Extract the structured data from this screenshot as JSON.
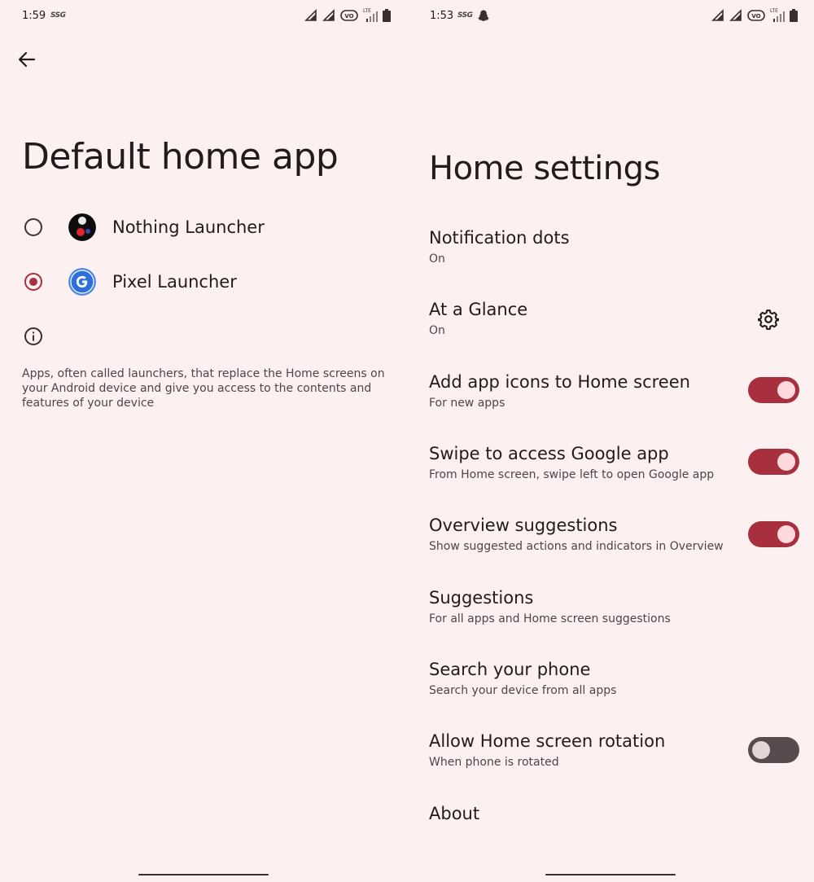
{
  "left_screen": {
    "status": {
      "time": "1:59",
      "network_label": "SSG"
    },
    "title": "Default home app",
    "options": [
      {
        "label": "Nothing Launcher",
        "selected": false,
        "icon": "nothing-launcher-icon"
      },
      {
        "label": "Pixel Launcher",
        "selected": true,
        "icon": "google-g-icon"
      }
    ],
    "info_text": "Apps, often called launchers, that replace the Home screens on your Android device and give you access to the contents and features of your device"
  },
  "right_screen": {
    "status": {
      "time": "1:53",
      "network_label": "SSG"
    },
    "title": "Home settings",
    "settings": [
      {
        "title": "Notification dots",
        "subtitle": "On"
      },
      {
        "title": "At a Glance",
        "subtitle": "On",
        "action": "gear-icon"
      },
      {
        "title": "Add app icons to Home screen",
        "subtitle": "For new apps",
        "toggle": true
      },
      {
        "title": "Swipe to access Google app",
        "subtitle": "From Home screen, swipe left to open Google app",
        "toggle": true
      },
      {
        "title": "Overview suggestions",
        "subtitle": "Show suggested actions and indicators in Overview",
        "toggle": true
      },
      {
        "title": "Suggestions",
        "subtitle": "For all apps and Home screen suggestions"
      },
      {
        "title": "Search your phone",
        "subtitle": "Search your device from all apps"
      },
      {
        "title": "Allow Home screen rotation",
        "subtitle": "When phone is rotated",
        "toggle": false
      },
      {
        "title": "About"
      }
    ]
  },
  "status_icons": {
    "lte_label": "LTE",
    "volte_label": "VO"
  },
  "colors": {
    "accent": "#a8303e",
    "background": "#fcf0f0",
    "text": "#231a1b",
    "subtext": "#52434a"
  }
}
